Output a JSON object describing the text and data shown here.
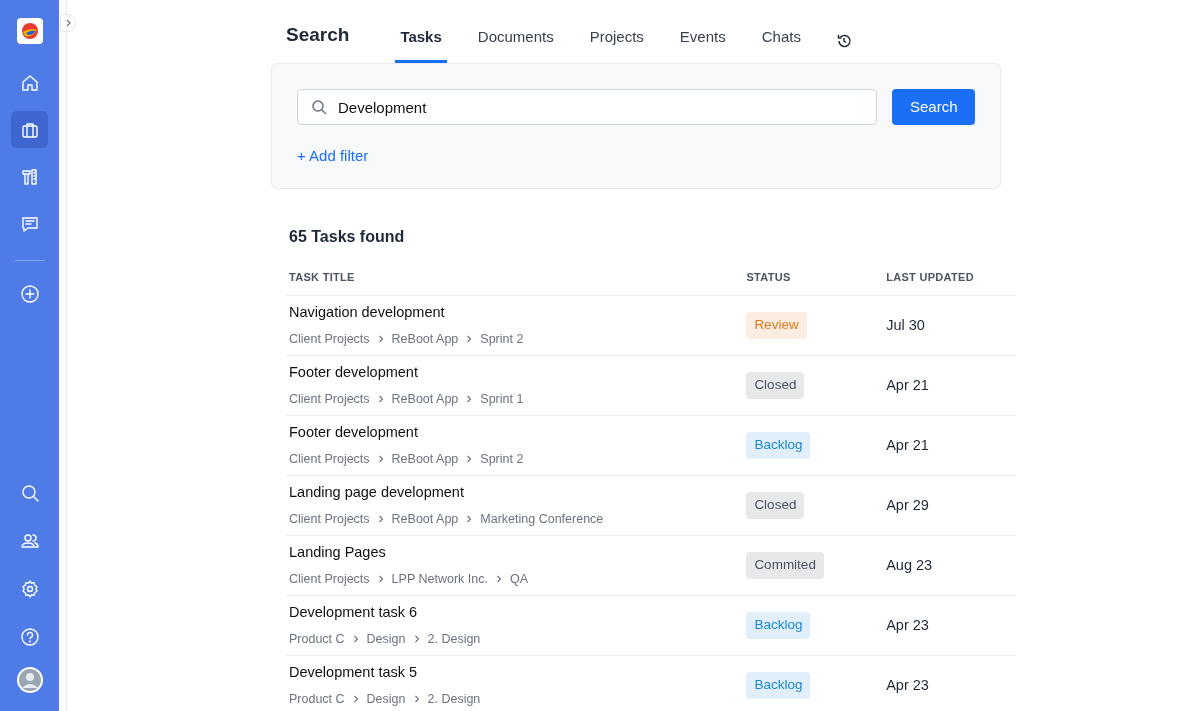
{
  "sidebar": {
    "top_items": [
      {
        "kind": "home",
        "selected": false
      },
      {
        "kind": "briefcase",
        "selected": true
      },
      {
        "kind": "tools",
        "selected": false
      },
      {
        "kind": "chat",
        "selected": false
      }
    ],
    "add_item": {
      "kind": "plus"
    },
    "bottom_items": [
      {
        "kind": "search"
      },
      {
        "kind": "people"
      },
      {
        "kind": "settings"
      },
      {
        "kind": "help"
      }
    ]
  },
  "header": {
    "title": "Search",
    "tabs": [
      {
        "label": "Tasks",
        "selected": true
      },
      {
        "label": "Documents",
        "selected": false
      },
      {
        "label": "Projects",
        "selected": false
      },
      {
        "label": "Events",
        "selected": false
      },
      {
        "label": "Chats",
        "selected": false
      }
    ]
  },
  "search": {
    "value": "Development",
    "button": "Search",
    "add_filter": "+ Add filter"
  },
  "results": {
    "count": "65 Tasks found",
    "columns": [
      "TASK TITLE",
      "STATUS",
      "LAST UPDATED"
    ],
    "rows": [
      {
        "title": "Navigation development",
        "path": [
          "Client Projects",
          "ReBoot App",
          "Sprint 2"
        ],
        "status": "Review",
        "color": "#e07a1f",
        "updated": "Jul 30"
      },
      {
        "title": "Footer development",
        "path": [
          "Client Projects",
          "ReBoot App",
          "Sprint 1"
        ],
        "status": "Closed",
        "color": "#4b5563",
        "updated": "Apr 21"
      },
      {
        "title": "Footer development",
        "path": [
          "Client Projects",
          "ReBoot App",
          "Sprint 2"
        ],
        "status": "Backlog",
        "color": "#1b87d6",
        "updated": "Apr 21"
      },
      {
        "title": "Landing page development",
        "path": [
          "Client Projects",
          "ReBoot App",
          "Marketing Conference"
        ],
        "status": "Closed",
        "color": "#4b5563",
        "updated": "Apr 29"
      },
      {
        "title": "Landing Pages",
        "path": [
          "Client Projects",
          "LPP Network Inc.",
          "QA"
        ],
        "status": "Commited",
        "color": "#4b5563",
        "updated": "Aug 23"
      },
      {
        "title": "Development task 6",
        "path": [
          "Product C",
          "Design",
          "2. Design"
        ],
        "status": "Backlog",
        "color": "#1b87d6",
        "updated": "Apr 23"
      },
      {
        "title": "Development task 5",
        "path": [
          "Product C",
          "Design",
          "2. Design"
        ],
        "status": "Backlog",
        "color": "#1b87d6",
        "updated": "Apr 23"
      }
    ]
  }
}
